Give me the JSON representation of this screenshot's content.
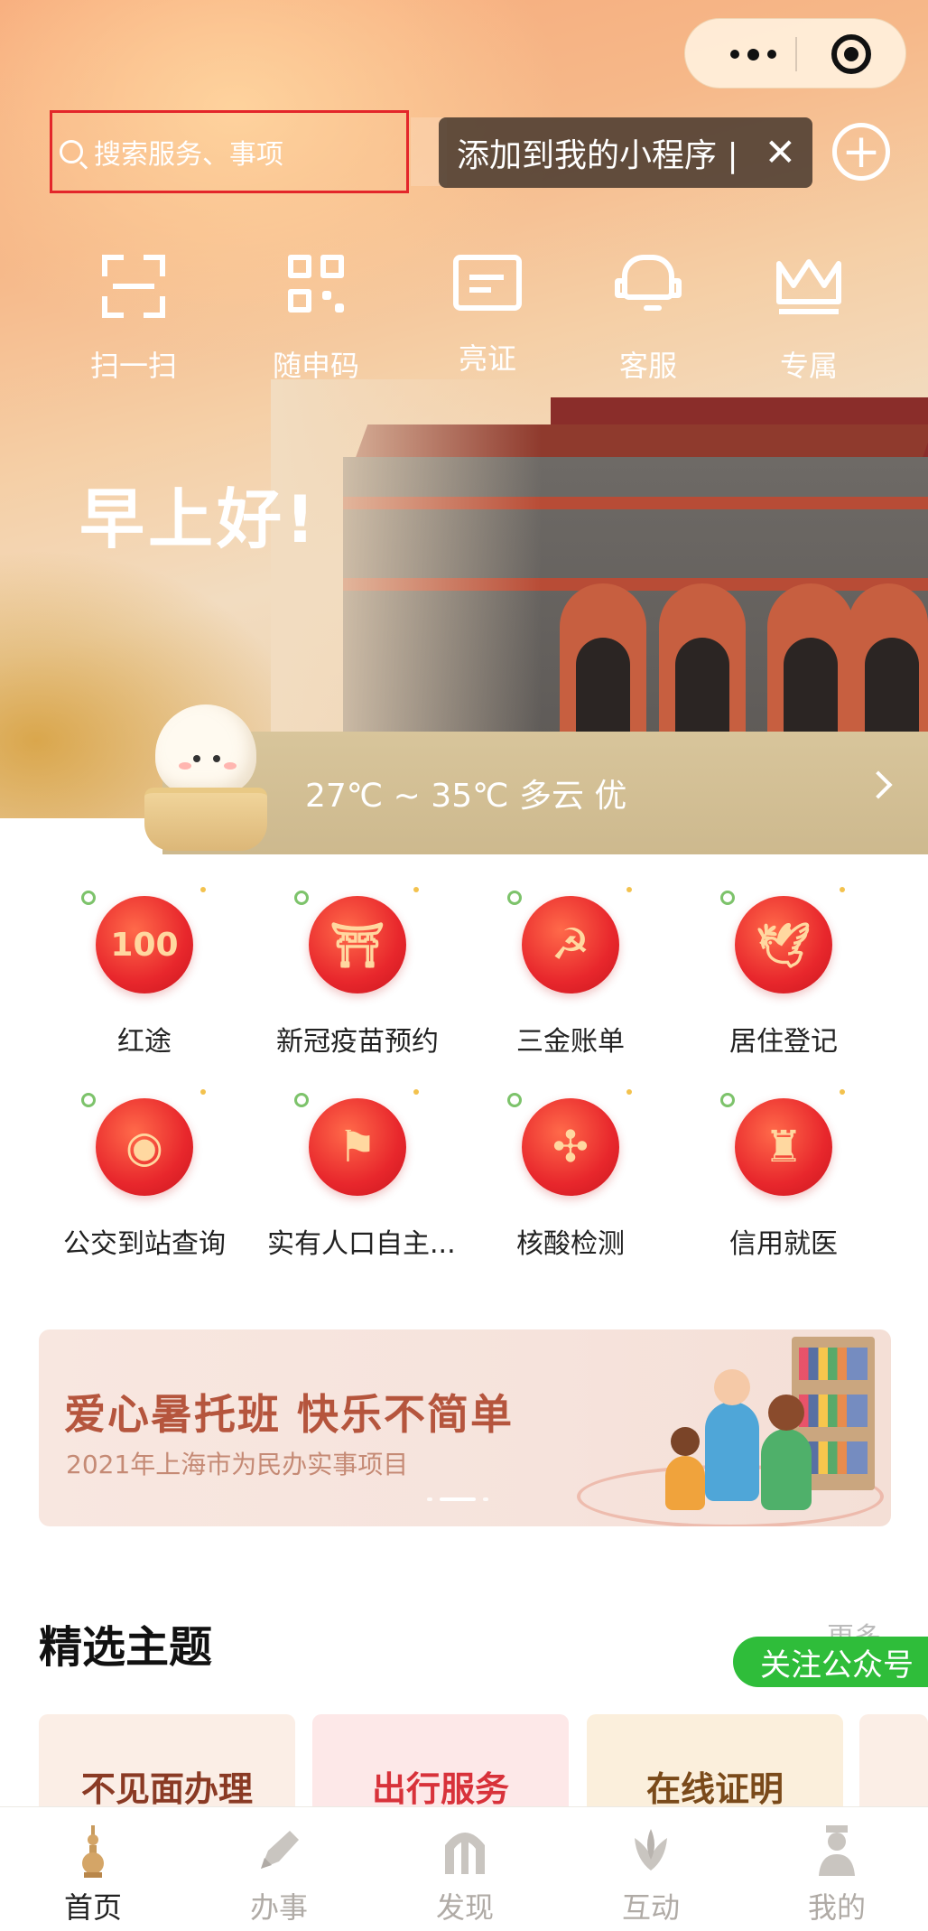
{
  "capsule": {
    "more_icon": "more-dots-icon",
    "close_icon": "target-circle-icon"
  },
  "search": {
    "placeholder": "搜索服务、事项",
    "icon": "search-icon"
  },
  "tooltip": {
    "text": "添加到我的小程序 |",
    "close": "✕"
  },
  "add_button": {
    "icon": "plus-circle-icon",
    "glyph": "+"
  },
  "quick_actions": [
    {
      "label": "扫一扫",
      "icon": "scan-icon"
    },
    {
      "label": "随申码",
      "icon": "qr-code-icon"
    },
    {
      "label": "亮证",
      "icon": "id-card-icon"
    },
    {
      "label": "客服",
      "icon": "headset-icon"
    },
    {
      "label": "专属",
      "icon": "crown-icon"
    }
  ],
  "greeting": "早上好!",
  "weather": {
    "text": "27℃ ~ 35℃ 多云 优",
    "chevron": "chevron-right-icon"
  },
  "services": [
    {
      "label": "红途",
      "icon": "100-anniversary-icon",
      "glyph": "100"
    },
    {
      "label": "新冠疫苗预约",
      "icon": "tiananmen-icon",
      "glyph": "⛩"
    },
    {
      "label": "三金账单",
      "icon": "hammer-sickle-icon",
      "glyph": "☭"
    },
    {
      "label": "居住登记",
      "icon": "dove-icon",
      "glyph": "🕊"
    },
    {
      "label": "公交到站查询",
      "icon": "drum-icon",
      "glyph": "◉"
    },
    {
      "label": "实有人口自主...",
      "icon": "flag-icon",
      "glyph": "⚑"
    },
    {
      "label": "核酸检测",
      "icon": "chinese-knot-icon",
      "glyph": "✣"
    },
    {
      "label": "信用就医",
      "icon": "monument-icon",
      "glyph": "♜"
    }
  ],
  "banner": {
    "title": "爱心暑托班  快乐不简单",
    "subtitle": "2021年上海市为民办实事项目"
  },
  "featured": {
    "title": "精选主题",
    "more": "更多",
    "follow": "关注公众号",
    "topics": [
      {
        "label": "不见面办理",
        "color": "#8a3a24",
        "bg": "#fbeee6"
      },
      {
        "label": "出行服务",
        "color": "#d8323a",
        "bg": "#fde8e8"
      },
      {
        "label": "在线证明",
        "color": "#7a4a1a",
        "bg": "#fbefdc"
      }
    ]
  },
  "tabbar": [
    {
      "label": "首页",
      "icon": "pagoda-icon",
      "active": true
    },
    {
      "label": "办事",
      "icon": "pen-icon",
      "active": false
    },
    {
      "label": "发现",
      "icon": "arch-gate-icon",
      "active": false
    },
    {
      "label": "互动",
      "icon": "magnolia-icon",
      "active": false
    },
    {
      "label": "我的",
      "icon": "person-icon",
      "active": false
    }
  ],
  "colors": {
    "accent_red": "#e3262a",
    "active_tab": "#222222",
    "inactive_tab": "#b0aba6",
    "follow_green": "#2fbd3a"
  }
}
